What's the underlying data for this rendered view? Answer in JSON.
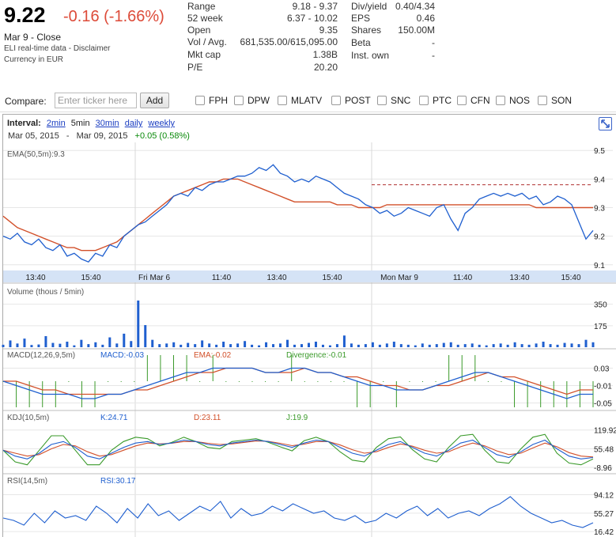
{
  "quote": {
    "price": "9.22",
    "change": "-0.16 (-1.66%)",
    "date_close": "Mar 9 - Close",
    "realtime_note": "ELI real-time data - Disclaimer",
    "currency": "Currency in EUR"
  },
  "stats_left": [
    {
      "label": "Range",
      "value": "9.18 - 9.37"
    },
    {
      "label": "52 week",
      "value": "6.37 - 10.02"
    },
    {
      "label": "Open",
      "value": "9.35"
    },
    {
      "label": "Vol / Avg.",
      "value": "681,535.00/615,095.00"
    },
    {
      "label": "Mkt cap",
      "value": "1.38B"
    },
    {
      "label": "P/E",
      "value": "20.20"
    }
  ],
  "stats_right": [
    {
      "label": "Div/yield",
      "value": "0.40/4.34"
    },
    {
      "label": "EPS",
      "value": "0.46"
    },
    {
      "label": "Shares",
      "value": "150.00M"
    },
    {
      "label": "Beta",
      "value": "-"
    },
    {
      "label": "Inst. own",
      "value": "-"
    }
  ],
  "compare": {
    "label": "Compare:",
    "placeholder": "Enter ticker here",
    "add_label": "Add",
    "tickers": [
      "FPH",
      "DPW",
      "MLATV",
      "POST",
      "SNC",
      "PTC",
      "CFN",
      "NOS",
      "SON"
    ]
  },
  "interval": {
    "label": "Interval:",
    "options": [
      {
        "label": "2min",
        "selected": false
      },
      {
        "label": "5min",
        "selected": true
      },
      {
        "label": "30min",
        "selected": false
      },
      {
        "label": "daily",
        "selected": false
      },
      {
        "label": "weekly",
        "selected": false
      }
    ]
  },
  "range": {
    "start": "Mar 05, 2015",
    "separator": "-",
    "end": "Mar 09, 2015",
    "gain": "+0.05 (0.58%)"
  },
  "colors": {
    "price": "#1f5fcf",
    "ema": "#d2502a",
    "macd": "#1f5fcf",
    "signal": "#d2502a",
    "divergence": "#3a9a2a",
    "kdj_k": "#1f5fcf",
    "kdj_d": "#d2502a",
    "kdj_j": "#3a9a2a",
    "axis_band": "#d5e3f6",
    "negative": "#dd4b39"
  },
  "chart_data": [
    {
      "type": "line",
      "panel": "price",
      "label": "EMA(50,5m):9.3",
      "ylim": [
        9.08,
        9.52
      ],
      "yticks": [
        9.1,
        9.2,
        9.3,
        9.4,
        9.5
      ],
      "ytick_labels": [
        "9.1",
        "9.2",
        "9.3",
        "9.4",
        "9.5"
      ],
      "x_labels": [
        "13:40",
        "15:40",
        "Fri Mar 6",
        "11:40",
        "13:40",
        "15:40",
        "Mon Mar 9",
        "11:40",
        "13:40",
        "15:40"
      ],
      "reference_line": 9.38,
      "series": [
        {
          "role": "price",
          "values": [
            9.2,
            9.19,
            9.21,
            9.18,
            9.17,
            9.19,
            9.16,
            9.15,
            9.17,
            9.13,
            9.14,
            9.12,
            9.11,
            9.14,
            9.13,
            9.17,
            9.16,
            9.2,
            9.22,
            9.24,
            9.25,
            9.27,
            9.29,
            9.31,
            9.34,
            9.35,
            9.34,
            9.37,
            9.36,
            9.38,
            9.39,
            9.39,
            9.4,
            9.41,
            9.41,
            9.42,
            9.44,
            9.43,
            9.45,
            9.42,
            9.41,
            9.39,
            9.4,
            9.39,
            9.41,
            9.4,
            9.39,
            9.37,
            9.35,
            9.34,
            9.33,
            9.31,
            9.3,
            9.28,
            9.29,
            9.27,
            9.28,
            9.3,
            9.29,
            9.28,
            9.27,
            9.3,
            9.31,
            9.26,
            9.22,
            9.28,
            9.3,
            9.33,
            9.34,
            9.35,
            9.34,
            9.35,
            9.34,
            9.35,
            9.33,
            9.34,
            9.31,
            9.32,
            9.34,
            9.33,
            9.31,
            9.25,
            9.19,
            9.22
          ]
        },
        {
          "role": "ema",
          "values": [
            9.27,
            9.25,
            9.23,
            9.22,
            9.21,
            9.2,
            9.19,
            9.18,
            9.17,
            9.16,
            9.16,
            9.15,
            9.15,
            9.15,
            9.16,
            9.17,
            9.18,
            9.2,
            9.22,
            9.24,
            9.26,
            9.28,
            9.3,
            9.32,
            9.34,
            9.35,
            9.36,
            9.37,
            9.38,
            9.39,
            9.39,
            9.4,
            9.4,
            9.4,
            9.39,
            9.38,
            9.37,
            9.36,
            9.35,
            9.34,
            9.33,
            9.32,
            9.32,
            9.32,
            9.32,
            9.32,
            9.32,
            9.31,
            9.31,
            9.31,
            9.3,
            9.3,
            9.3,
            9.3,
            9.31,
            9.31,
            9.31,
            9.31,
            9.31,
            9.31,
            9.31,
            9.31,
            9.31,
            9.31,
            9.31,
            9.31,
            9.31,
            9.31,
            9.31,
            9.31,
            9.31,
            9.31,
            9.31,
            9.31,
            9.31,
            9.3,
            9.3,
            9.3,
            9.3,
            9.3,
            9.3,
            9.3,
            9.3,
            9.3
          ]
        }
      ]
    },
    {
      "type": "bar",
      "panel": "volume",
      "label": "Volume (thous / 5min)",
      "ylim": [
        0,
        380
      ],
      "yticks": [
        175,
        350
      ],
      "ytick_labels": [
        "175",
        "350"
      ],
      "values": [
        20,
        55,
        30,
        70,
        18,
        22,
        90,
        35,
        28,
        45,
        15,
        60,
        25,
        40,
        20,
        80,
        30,
        110,
        50,
        380,
        180,
        60,
        25,
        30,
        40,
        20,
        35,
        25,
        55,
        30,
        20,
        45,
        25,
        30,
        50,
        20,
        15,
        40,
        25,
        30,
        60,
        20,
        25,
        35,
        45,
        20,
        15,
        25,
        95,
        30,
        20,
        25,
        40,
        20,
        30,
        45,
        25,
        20,
        15,
        30,
        20,
        25,
        35,
        40,
        20,
        25,
        30,
        20,
        15,
        25,
        30,
        20,
        40,
        25,
        20,
        30,
        45,
        25,
        20,
        35,
        30,
        25,
        60,
        40
      ]
    },
    {
      "type": "line",
      "panel": "macd",
      "label": "MACD(12,26,9,5m)",
      "macd_label": "MACD:-0.03",
      "ema_label": "EMA:-0.02",
      "divergence_label": "Divergence:-0.01",
      "ylim": [
        -0.06,
        0.04
      ],
      "yticks": [
        0.03,
        -0.01,
        -0.05
      ],
      "ytick_labels": [
        "0.03",
        "-0.01",
        "-0.05"
      ],
      "series": [
        {
          "role": "macd",
          "values": [
            0.0,
            -0.01,
            -0.02,
            -0.03,
            -0.03,
            -0.03,
            -0.04,
            -0.04,
            -0.03,
            -0.03,
            -0.02,
            -0.01,
            0.0,
            0.01,
            0.02,
            0.02,
            0.03,
            0.03,
            0.03,
            0.03,
            0.02,
            0.02,
            0.03,
            0.03,
            0.02,
            0.02,
            0.01,
            0.0,
            -0.01,
            -0.01,
            -0.02,
            -0.02,
            -0.02,
            -0.01,
            0.0,
            0.01,
            0.02,
            0.02,
            0.01,
            0.0,
            -0.01,
            -0.02,
            -0.03,
            -0.04,
            -0.03,
            -0.03
          ]
        },
        {
          "role": "signal",
          "values": [
            0.0,
            0.0,
            -0.01,
            -0.02,
            -0.02,
            -0.03,
            -0.03,
            -0.03,
            -0.03,
            -0.03,
            -0.02,
            -0.02,
            -0.01,
            0.0,
            0.01,
            0.02,
            0.02,
            0.03,
            0.03,
            0.03,
            0.02,
            0.02,
            0.02,
            0.03,
            0.02,
            0.02,
            0.01,
            0.01,
            0.0,
            -0.01,
            -0.01,
            -0.02,
            -0.02,
            -0.01,
            -0.01,
            0.0,
            0.01,
            0.02,
            0.01,
            0.01,
            0.0,
            -0.01,
            -0.02,
            -0.03,
            -0.02,
            -0.02
          ]
        }
      ]
    },
    {
      "type": "line",
      "panel": "kdj",
      "label": "KDJ(10,5m)",
      "k_label": "K:24.71",
      "d_label": "D:23.11",
      "j_label": "J:19.9",
      "ylim": [
        -20,
        130
      ],
      "yticks": [
        119.92,
        55.48,
        -8.96
      ],
      "ytick_labels": [
        "119.92",
        "55.48",
        "-8.96"
      ],
      "series": [
        {
          "role": "k",
          "values": [
            50,
            30,
            20,
            40,
            70,
            80,
            60,
            30,
            20,
            40,
            60,
            75,
            80,
            70,
            75,
            85,
            80,
            70,
            65,
            75,
            80,
            85,
            80,
            70,
            60,
            75,
            85,
            80,
            60,
            40,
            30,
            50,
            70,
            80,
            60,
            40,
            30,
            50,
            75,
            85,
            60,
            35,
            25,
            45,
            70,
            85,
            55,
            30,
            20,
            25
          ]
        },
        {
          "role": "d",
          "values": [
            50,
            40,
            30,
            35,
            55,
            70,
            65,
            45,
            30,
            35,
            50,
            65,
            75,
            72,
            74,
            80,
            80,
            74,
            70,
            72,
            77,
            82,
            81,
            74,
            66,
            71,
            80,
            80,
            68,
            52,
            40,
            45,
            60,
            72,
            64,
            50,
            40,
            45,
            62,
            75,
            65,
            48,
            35,
            40,
            58,
            75,
            62,
            42,
            30,
            27
          ]
        },
        {
          "role": "j",
          "values": [
            50,
            10,
            0,
            50,
            100,
            100,
            50,
            0,
            0,
            50,
            80,
            95,
            90,
            65,
            77,
            95,
            80,
            60,
            55,
            80,
            85,
            90,
            78,
            62,
            48,
            83,
            95,
            80,
            44,
            16,
            10,
            60,
            90,
            96,
            52,
            20,
            10,
            60,
            100,
            105,
            50,
            10,
            5,
            55,
            95,
            105,
            40,
            6,
            0,
            20
          ]
        }
      ]
    },
    {
      "type": "line",
      "panel": "rsi",
      "label": "RSI(14,5m)",
      "rsi_label": "RSI:30.17",
      "ylim": [
        10,
        100
      ],
      "yticks": [
        94.12,
        55.27,
        16.42
      ],
      "ytick_labels": [
        "94.12",
        "55.27",
        "16.42"
      ],
      "series": [
        {
          "role": "rsi",
          "values": [
            45,
            40,
            30,
            55,
            35,
            60,
            45,
            50,
            40,
            70,
            55,
            35,
            65,
            45,
            75,
            50,
            60,
            40,
            55,
            70,
            60,
            80,
            45,
            65,
            50,
            55,
            70,
            60,
            75,
            65,
            55,
            60,
            45,
            40,
            50,
            35,
            40,
            55,
            45,
            60,
            70,
            50,
            65,
            45,
            55,
            60,
            50,
            65,
            75,
            90,
            70,
            55,
            45,
            35,
            40,
            30,
            25,
            35
          ]
        }
      ]
    }
  ]
}
